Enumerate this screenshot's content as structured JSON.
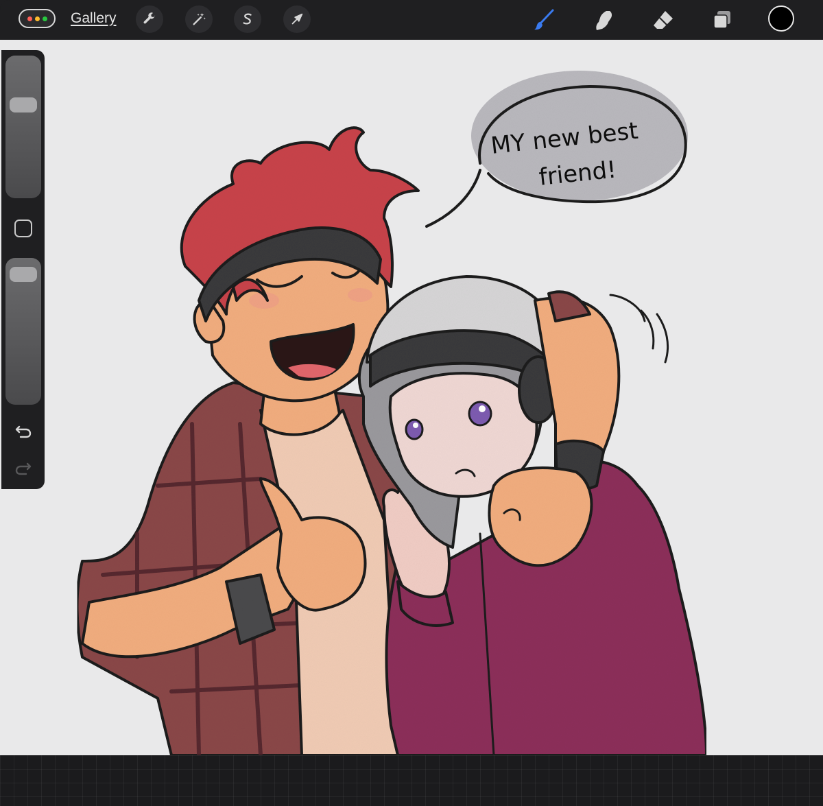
{
  "toolbar": {
    "gallery_label": "Gallery",
    "left_tools": [
      {
        "name": "actions",
        "icon": "wrench-icon"
      },
      {
        "name": "adjustments",
        "icon": "magic-wand-icon"
      },
      {
        "name": "selection",
        "icon": "selection-s-icon"
      },
      {
        "name": "transform",
        "icon": "arrow-cursor-icon"
      }
    ],
    "right_tools": [
      {
        "name": "brush",
        "icon": "brush-icon",
        "active": true
      },
      {
        "name": "smudge",
        "icon": "smudge-icon"
      },
      {
        "name": "eraser",
        "icon": "eraser-icon"
      },
      {
        "name": "layers",
        "icon": "layers-icon"
      }
    ],
    "current_color": "#000000",
    "accent": "#3a7bf0"
  },
  "sidebar": {
    "brush_size_level": 0.68,
    "opacity_level": 0.95,
    "undo_icon": "undo-arrow-icon",
    "redo_icon": "redo-arrow-icon"
  },
  "canvas": {
    "speech_bubble": {
      "line1": "MY new best",
      "line2": "friend!"
    }
  }
}
